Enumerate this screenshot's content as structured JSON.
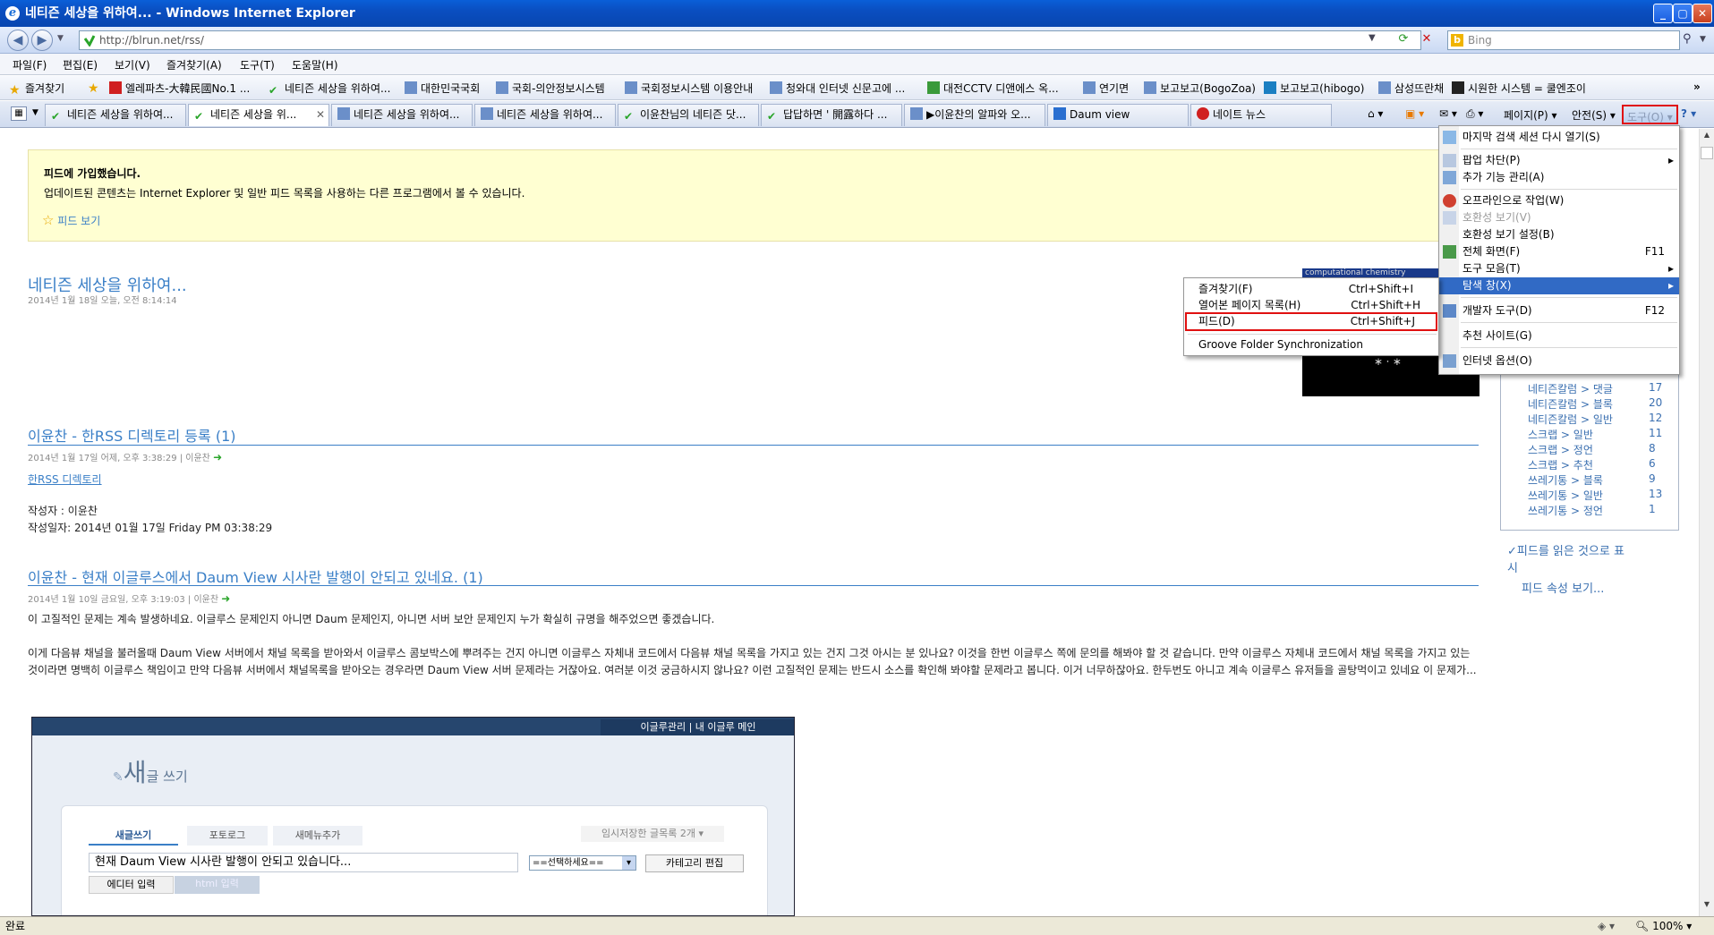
{
  "window": {
    "title": "네티즌 세상을 위하여... - Windows Internet Explorer"
  },
  "address": {
    "url": "http://blrun.net/rss/",
    "search_placeholder": "Bing"
  },
  "menubar": [
    "파일(F)",
    "편집(E)",
    "보기(V)",
    "즐겨찾기(A)",
    "도구(T)",
    "도움말(H)"
  ],
  "favorites": {
    "label": "즐겨찾기",
    "items": [
      "엘레파츠-大韓民國No.1 ...",
      "네티즌 세상을 위하여...",
      "대한민국국회",
      "국회-의안정보시스템",
      "국회정보시스템 이용안내",
      "청와대 인터넷 신문고에 ...",
      "대전CCTV 디앤에스 옥...",
      "연기면",
      "보고보고(BogoZoa)",
      "보고보고(hibogo)",
      "삼성뜨란채",
      "시원한 시스템 = 쿨엔조이"
    ]
  },
  "tabs": [
    {
      "label": "네티즌 세상을 위하여..."
    },
    {
      "label": "네티즌 세상을 위..."
    },
    {
      "label": "네티즌 세상을 위하여..."
    },
    {
      "label": "네티즌 세상을 위하여..."
    },
    {
      "label": "이윤찬님의 네티즌 닷..."
    },
    {
      "label": "답답하면 ' 開露하다 ..."
    },
    {
      "label": "▶이윤찬의 알파와 오..."
    },
    {
      "label": "Daum view"
    },
    {
      "label": "네이트 뉴스"
    }
  ],
  "commandbar": {
    "page": "페이지(P)",
    "safety": "안전(S)",
    "tools": "도구(O)"
  },
  "notice": {
    "heading": "피드에 가입했습니다.",
    "text": "업데이트된 콘텐츠는 Internet Explorer 및 일반 피드 목록을 사용하는 다른 프로그램에서 볼 수 있습니다.",
    "link": "피드 보기"
  },
  "feed": {
    "title": "네티즌 세상을 위하여...",
    "date": "2014년 1월 18일 오늘, 오전 8:14:14",
    "image_caption": "computational chemistry"
  },
  "posts": [
    {
      "title": "이윤찬 - 한RSS 디렉토리 등록 (1)",
      "meta": "2014년 1월 17일 어제, 오후 3:38:29 | 이윤찬",
      "link": "한RSS 디렉토리",
      "author": "작성자 : 이윤찬",
      "written": "작성일자: 2014년 01월 17일 Friday PM 03:38:29"
    },
    {
      "title": "이윤찬 - 현재 이글루스에서 Daum View 시사란 발행이 안되고 있네요. (1)",
      "meta": "2014년 1월 10일 금요일, 오후 3:19:03 | 이윤찬",
      "p1": "이 고질적인 문제는 계속 발생하네요. 이글루스 문제인지 아니면 Daum 문제인지, 아니면 서버 보안 문제인지 누가 확실히 규명을 해주었으면 좋겠습니다.",
      "p2": "이게 다음뷰 채널을 불러올때 Daum View 서버에서 채널 목록을 받아와서 이글루스 콤보박스에 뿌려주는 건지 아니면 이글루스 자체내 코드에서 다음뷰 채널 목록을 가지고 있는 건지 그것 아시는 분 있나요? 이것을 한번 이글루스 쪽에 문의를 해봐야 할 것 같습니다. 만약 이글루스 자체내 코드에서 채널 목록을 가지고 있는 것이라면 명백히 이글루스 책임이고 만약 다음뷰 서버에서 채널목록을 받아오는 경우라면 Daum View 서버 문제라는 거잖아요. 여러분 이것 궁금하시지 않나요? 이런 고질적인 문제는 반드시 소스를 확인해 봐야할 문제라고 봅니다. 이거 너무하잖아요. 한두번도 아니고 계속 이글루스 유저들을 골탕먹이고 있네요 이 문제가..."
    }
  ],
  "embed": {
    "topnav": "이글루관리 | 내 이글루 메인",
    "logo_big": "새",
    "logo_small": "글 쓰기",
    "tabs": [
      "새글쓰기",
      "포토로그",
      "새메뉴추가"
    ],
    "draft": "임시저장한 글목록 2개",
    "title_value": "현재 Daum View 시사란 발행이 안되고 있습니다...",
    "select": "==선택하세요==",
    "category_btn": "카테고리 편집",
    "editor_tabs": [
      "에디터 입력",
      "html 입력"
    ]
  },
  "sidebar": {
    "items": [
      {
        "label": "네티즌칼럼 > 댓글",
        "n": "17"
      },
      {
        "label": "네티즌칼럼 > 블록",
        "n": "20"
      },
      {
        "label": "네티즌칼럼 > 일반",
        "n": "12"
      },
      {
        "label": "스크랩 > 일반",
        "n": "11"
      },
      {
        "label": "스크랩 > 정언",
        "n": "8"
      },
      {
        "label": "스크랩 > 추천",
        "n": "6"
      },
      {
        "label": "쓰레기통 > 블록",
        "n": "9"
      },
      {
        "label": "쓰레기통 > 일반",
        "n": "13"
      },
      {
        "label": "쓰레기통 > 정언",
        "n": "1"
      }
    ],
    "mark_read_1": "피드를 읽은 것으로 표",
    "mark_read_2": "시",
    "properties": "피드 속성 보기..."
  },
  "tools_menu": {
    "items": [
      {
        "label": "마지막 검색 세션 다시 열기(S)"
      },
      {
        "label": "팝업 차단(P)"
      },
      {
        "label": "추가 기능 관리(A)"
      },
      {
        "label": "오프라인으로 작업(W)"
      },
      {
        "label": "호환성 보기(V)"
      },
      {
        "label": "호환성 보기 설정(B)"
      },
      {
        "label": "전체 화면(F)",
        "shortcut": "F11"
      },
      {
        "label": "도구 모음(T)"
      },
      {
        "label": "탐색 창(X)"
      },
      {
        "label": "개발자 도구(D)",
        "shortcut": "F12"
      },
      {
        "label": "추천 사이트(G)"
      },
      {
        "label": "인터넷 옵션(O)"
      }
    ]
  },
  "explorer_submenu": {
    "items": [
      {
        "label": "즐겨찾기(F)",
        "shortcut": "Ctrl+Shift+I"
      },
      {
        "label": "열어본 페이지 목록(H)",
        "shortcut": "Ctrl+Shift+H"
      },
      {
        "label": "피드(D)",
        "shortcut": "Ctrl+Shift+J"
      },
      {
        "label": "Groove Folder Synchronization"
      }
    ]
  },
  "status": {
    "text": "완료",
    "zoom": "100%"
  },
  "colors": {
    "accent": "#3a7fc7",
    "highlight": "#316ac5",
    "red_box": "#e01010",
    "notice_bg": "#ffffd2"
  }
}
